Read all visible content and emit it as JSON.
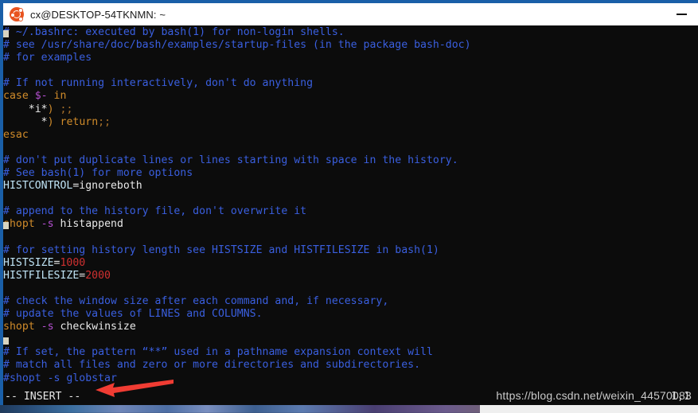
{
  "window": {
    "title": "cx@DESKTOP-54TKNMN: ~",
    "icon": "ubuntu-logo-icon",
    "minimize_label": "—",
    "accent_color": "#1a5fa8",
    "titlebar_bg": "#ffffff",
    "terminal_bg": "#0c0c0c"
  },
  "editor": {
    "mode_label": "-- INSERT --",
    "cursor_position": "1,1",
    "colors": {
      "comment": "#3a5fe0",
      "keyword": "#d08b2a",
      "variable": "#b44fd0",
      "number": "#d03030",
      "plain": "#e8e8e8",
      "identifier": "#bfe3f5"
    },
    "lines": [
      [
        {
          "t": "# ~/.bashrc: executed by bash(1) for non-login shells.",
          "c": "c-comment"
        }
      ],
      [
        {
          "t": "# see /usr/share/doc/bash/examples/startup-files (in the package bash-doc)",
          "c": "c-comment"
        }
      ],
      [
        {
          "t": "# for examples",
          "c": "c-comment"
        }
      ],
      [],
      [
        {
          "t": "# If not running interactively, don't do anything",
          "c": "c-comment"
        }
      ],
      [
        {
          "t": "case ",
          "c": "c-kw"
        },
        {
          "t": "$-",
          "c": "c-var"
        },
        {
          "t": " in",
          "c": "c-kw"
        }
      ],
      [
        {
          "t": "    ",
          "c": "c-plain"
        },
        {
          "t": "*i*",
          "c": "c-plain"
        },
        {
          "t": ")",
          "c": "c-kw"
        },
        {
          "t": " ",
          "c": "c-plain"
        },
        {
          "t": ";;",
          "c": "c-kw-dim"
        }
      ],
      [
        {
          "t": "      ",
          "c": "c-plain"
        },
        {
          "t": "*",
          "c": "c-plain"
        },
        {
          "t": ")",
          "c": "c-kw"
        },
        {
          "t": " ",
          "c": "c-plain"
        },
        {
          "t": "return",
          "c": "c-kw"
        },
        {
          "t": ";;",
          "c": "c-kw-dim"
        }
      ],
      [
        {
          "t": "esac",
          "c": "c-kw"
        }
      ],
      [],
      [
        {
          "t": "# don't put duplicate lines or lines starting with space in the history.",
          "c": "c-comment"
        }
      ],
      [
        {
          "t": "# See bash(1) for more options",
          "c": "c-comment"
        }
      ],
      [
        {
          "t": "HISTCONTROL",
          "c": "c-ident"
        },
        {
          "t": "=ignoreboth",
          "c": "c-plain"
        }
      ],
      [],
      [
        {
          "t": "# append to the history file, don't overwrite it",
          "c": "c-comment"
        }
      ],
      [
        {
          "t": "shopt",
          "c": "c-kw"
        },
        {
          "t": " ",
          "c": "c-plain"
        },
        {
          "t": "-s",
          "c": "c-var"
        },
        {
          "t": " histappend",
          "c": "c-plain"
        }
      ],
      [],
      [
        {
          "t": "# for setting history length see HISTSIZE and HISTFILESIZE in bash(1)",
          "c": "c-comment"
        }
      ],
      [
        {
          "t": "HISTSIZE",
          "c": "c-ident"
        },
        {
          "t": "=",
          "c": "c-plain"
        },
        {
          "t": "1000",
          "c": "c-num"
        }
      ],
      [
        {
          "t": "HISTFILESIZE",
          "c": "c-ident"
        },
        {
          "t": "=",
          "c": "c-plain"
        },
        {
          "t": "2000",
          "c": "c-num"
        }
      ],
      [],
      [
        {
          "t": "# check the window size after each command and, if necessary,",
          "c": "c-comment"
        }
      ],
      [
        {
          "t": "# update the values of LINES and COLUMNS.",
          "c": "c-comment"
        }
      ],
      [
        {
          "t": "shopt",
          "c": "c-kw"
        },
        {
          "t": " ",
          "c": "c-plain"
        },
        {
          "t": "-s",
          "c": "c-var"
        },
        {
          "t": " checkwinsize",
          "c": "c-plain"
        }
      ],
      [],
      [
        {
          "t": "# If set, the pattern “**” used in a pathname expansion context will",
          "c": "c-comment"
        }
      ],
      [
        {
          "t": "# match all files and zero or more directories and subdirectories.",
          "c": "c-comment"
        }
      ],
      [
        {
          "t": "#shopt -s globstar",
          "c": "c-comment"
        }
      ]
    ]
  },
  "annotation": {
    "arrow_color": "#f03c33",
    "arrow_name": "red-pointer-arrow"
  },
  "watermark": {
    "text": "https://blog.csdn.net/weixin_44570083"
  }
}
